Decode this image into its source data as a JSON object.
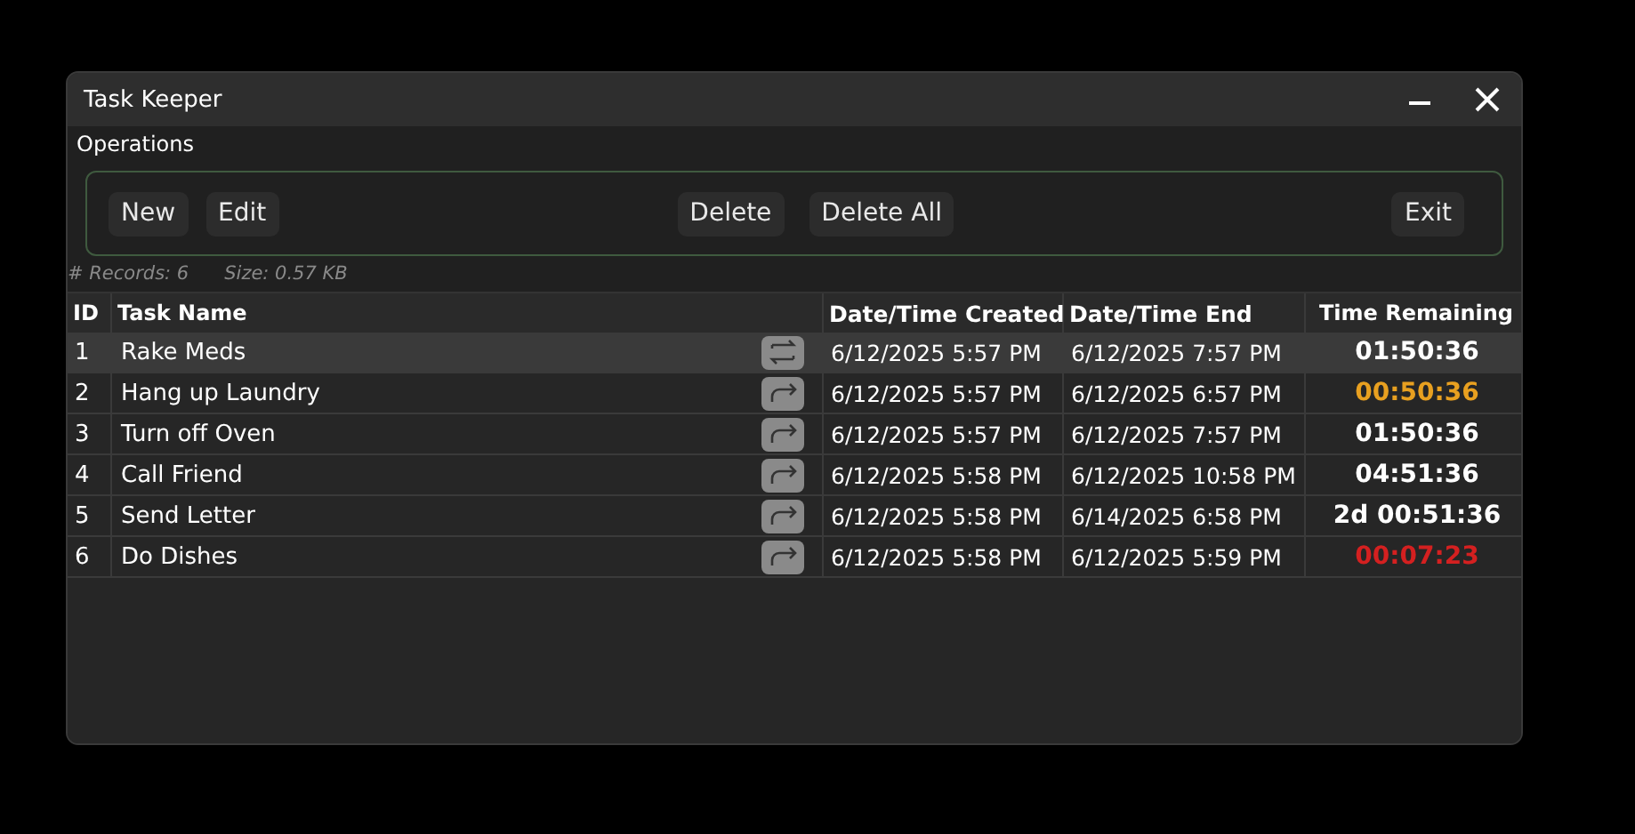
{
  "window": {
    "title": "Task Keeper"
  },
  "menu": [
    {
      "label": "Operations"
    }
  ],
  "toolbar": {
    "groups": [
      {
        "buttons": [
          {
            "label": "New"
          },
          {
            "label": "Edit"
          }
        ]
      },
      {
        "buttons": [
          {
            "label": "Delete"
          },
          {
            "label": "Delete All"
          }
        ]
      },
      {
        "buttons": [
          {
            "label": "Exit"
          }
        ]
      }
    ]
  },
  "status": {
    "records": "# Records: 6",
    "size": "Size: 0.57 KB"
  },
  "table": {
    "columns": [
      "ID",
      "Task Name",
      "Date/Time Created",
      "Date/Time End",
      "Time Remaining"
    ],
    "rows": [
      {
        "id": "1",
        "name": "Rake Meds",
        "kind": "repeating",
        "created": "6/12/2025 5:57 PM",
        "end": "6/12/2025 7:57 PM",
        "remaining": "01:50:36",
        "color": "#ffffff",
        "selected": true
      },
      {
        "id": "2",
        "name": "Hang up Laundry",
        "kind": "single",
        "created": "6/12/2025 5:57 PM",
        "end": "6/12/2025 6:57 PM",
        "remaining": "00:50:36",
        "color": "#e8a020",
        "selected": false
      },
      {
        "id": "3",
        "name": "Turn off Oven",
        "kind": "single",
        "created": "6/12/2025 5:57 PM",
        "end": "6/12/2025 7:57 PM",
        "remaining": "01:50:36",
        "color": "#ffffff",
        "selected": false
      },
      {
        "id": "4",
        "name": "Call Friend",
        "kind": "single",
        "created": "6/12/2025 5:58 PM",
        "end": "6/12/2025 10:58 PM",
        "remaining": "04:51:36",
        "color": "#ffffff",
        "selected": false
      },
      {
        "id": "5",
        "name": "Send Letter",
        "kind": "single",
        "created": "6/12/2025 5:58 PM",
        "end": "6/14/2025 6:58 PM",
        "remaining": "2d 00:51:36",
        "color": "#ffffff",
        "selected": false
      },
      {
        "id": "6",
        "name": "Do Dishes",
        "kind": "single",
        "created": "6/12/2025 5:58 PM",
        "end": "6/12/2025 5:59 PM",
        "remaining": "00:07:23",
        "color": "#d42020",
        "selected": false
      }
    ]
  }
}
